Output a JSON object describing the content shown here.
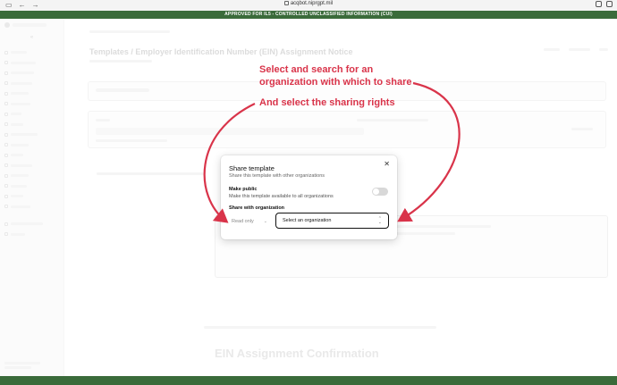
{
  "browser": {
    "url": "acqbot.niprgpt.mil"
  },
  "banner": {
    "text": "APPROVED FOR IL5 - CONTROLLED UNCLASSIFIED INFORMATION (CUI)"
  },
  "background": {
    "page_title": "Templates / Employer Identification Number (EIN) Assignment Notice",
    "ein_heading": "EIN Assignment Confirmation"
  },
  "modal": {
    "title": "Share template",
    "subtitle": "Share this template with other organizations",
    "make_public_label": "Make public",
    "make_public_desc": "Make this template available to all organizations",
    "make_public_on": false,
    "share_with_org_label": "Share with organization",
    "rights_value": "Read only",
    "org_placeholder": "Select an organization"
  },
  "annotations": {
    "line1": "Select and search for an",
    "line2": "organization with which to share",
    "line3": "And select the sharing rights",
    "color": "#d9344a"
  }
}
